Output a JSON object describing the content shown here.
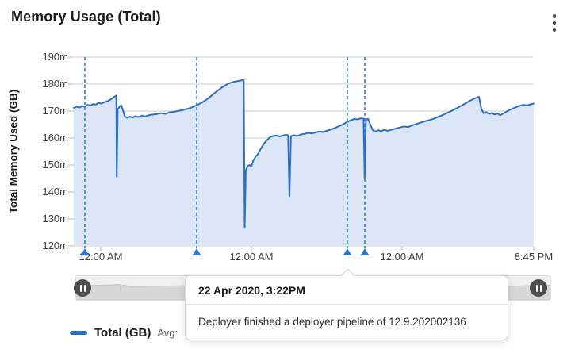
{
  "header": {
    "title": "Memory Usage (Total)"
  },
  "colors": {
    "line": "#2b6fc2",
    "fill": "#dbe5f6",
    "annotation": "#2f72cf",
    "grid": "#cccccc",
    "tick": "#b5b5b5",
    "axis_text": "#3c3c3c",
    "slider_chart_fill": "#d6d6d6",
    "slider_chart_stroke": "#c4c4c4",
    "slider_handle": "#4d4d4d"
  },
  "chart_data": {
    "type": "area",
    "title": "Memory Usage (Total)",
    "ylabel": "Total Memory Used (GB)",
    "xlabel": "",
    "ylim": [
      120,
      190
    ],
    "grid": true,
    "y_ticks": [
      {
        "value": 190,
        "label": "190m"
      },
      {
        "value": 180,
        "label": "180m"
      },
      {
        "value": 170,
        "label": "170m"
      },
      {
        "value": 160,
        "label": "160m"
      },
      {
        "value": 150,
        "label": "150m"
      },
      {
        "value": 140,
        "label": "140m"
      },
      {
        "value": 130,
        "label": "130m"
      },
      {
        "value": 120,
        "label": "120m"
      }
    ],
    "x_ticks": [
      {
        "f": 0.0586,
        "label": "12:00 AM"
      },
      {
        "f": 0.3862,
        "label": "12:00 AM"
      },
      {
        "f": 0.7138,
        "label": "12:00 AM"
      },
      {
        "f": 1.0,
        "label": "8:45 PM"
      }
    ],
    "annotations": [
      {
        "f": 0.0241
      },
      {
        "f": 0.2672
      },
      {
        "f": 0.5948,
        "tooltip_target": true
      },
      {
        "f": 0.6328
      }
    ],
    "series": [
      {
        "name": "Total (GB)",
        "points": [
          [
            0.0,
            171.2
          ],
          [
            0.006,
            171.6
          ],
          [
            0.012,
            171.3
          ],
          [
            0.018,
            171.9
          ],
          [
            0.024,
            171.6
          ],
          [
            0.03,
            172.3
          ],
          [
            0.036,
            172.1
          ],
          [
            0.042,
            172.6
          ],
          [
            0.048,
            172.4
          ],
          [
            0.054,
            173.0
          ],
          [
            0.06,
            172.8
          ],
          [
            0.066,
            173.3
          ],
          [
            0.072,
            173.6
          ],
          [
            0.078,
            174.1
          ],
          [
            0.083,
            174.6
          ],
          [
            0.087,
            175.2
          ],
          [
            0.09,
            175.5
          ],
          [
            0.0925,
            175.8
          ],
          [
            0.0935,
            145.7
          ],
          [
            0.0955,
            170.6
          ],
          [
            0.099,
            171.5
          ],
          [
            0.103,
            172.2
          ],
          [
            0.107,
            170.2
          ],
          [
            0.111,
            168.0
          ],
          [
            0.116,
            167.5
          ],
          [
            0.122,
            167.9
          ],
          [
            0.128,
            167.6
          ],
          [
            0.134,
            168.1
          ],
          [
            0.141,
            167.8
          ],
          [
            0.148,
            168.3
          ],
          [
            0.156,
            168.0
          ],
          [
            0.164,
            168.5
          ],
          [
            0.172,
            168.7
          ],
          [
            0.181,
            168.9
          ],
          [
            0.19,
            169.2
          ],
          [
            0.199,
            169.0
          ],
          [
            0.208,
            169.5
          ],
          [
            0.217,
            169.7
          ],
          [
            0.226,
            170.0
          ],
          [
            0.235,
            170.3
          ],
          [
            0.244,
            170.7
          ],
          [
            0.253,
            171.1
          ],
          [
            0.262,
            171.8
          ],
          [
            0.271,
            172.5
          ],
          [
            0.28,
            173.3
          ],
          [
            0.289,
            174.3
          ],
          [
            0.298,
            175.5
          ],
          [
            0.307,
            176.8
          ],
          [
            0.316,
            178.0
          ],
          [
            0.325,
            179.1
          ],
          [
            0.334,
            180.0
          ],
          [
            0.343,
            180.6
          ],
          [
            0.352,
            181.0
          ],
          [
            0.36,
            181.2
          ],
          [
            0.367,
            181.5
          ],
          [
            0.3695,
            181.5
          ],
          [
            0.3715,
            127.0
          ],
          [
            0.374,
            148.0
          ],
          [
            0.378,
            149.5
          ],
          [
            0.382,
            150.0
          ],
          [
            0.386,
            149.5
          ],
          [
            0.39,
            151.5
          ],
          [
            0.395,
            153.0
          ],
          [
            0.4,
            154.0
          ],
          [
            0.405,
            155.5
          ],
          [
            0.41,
            157.0
          ],
          [
            0.415,
            158.3
          ],
          [
            0.42,
            159.2
          ],
          [
            0.426,
            160.2
          ],
          [
            0.432,
            160.7
          ],
          [
            0.44,
            160.9
          ],
          [
            0.448,
            160.6
          ],
          [
            0.456,
            161.0
          ],
          [
            0.462,
            161.2
          ],
          [
            0.466,
            161.0
          ],
          [
            0.469,
            138.5
          ],
          [
            0.472,
            160.7
          ],
          [
            0.478,
            161.0
          ],
          [
            0.486,
            160.8
          ],
          [
            0.494,
            161.3
          ],
          [
            0.502,
            161.6
          ],
          [
            0.51,
            161.9
          ],
          [
            0.518,
            161.7
          ],
          [
            0.526,
            162.1
          ],
          [
            0.534,
            162.4
          ],
          [
            0.542,
            162.2
          ],
          [
            0.55,
            162.7
          ],
          [
            0.558,
            163.1
          ],
          [
            0.566,
            163.6
          ],
          [
            0.574,
            164.2
          ],
          [
            0.582,
            164.8
          ],
          [
            0.589,
            165.4
          ],
          [
            0.596,
            166.1
          ],
          [
            0.603,
            166.6
          ],
          [
            0.61,
            167.1
          ],
          [
            0.617,
            166.9
          ],
          [
            0.624,
            167.3
          ],
          [
            0.63,
            167.2
          ],
          [
            0.6325,
            145.3
          ],
          [
            0.635,
            166.9
          ],
          [
            0.64,
            167.1
          ],
          [
            0.645,
            164.8
          ],
          [
            0.65,
            162.9
          ],
          [
            0.656,
            162.4
          ],
          [
            0.662,
            162.9
          ],
          [
            0.668,
            162.5
          ],
          [
            0.675,
            163.0
          ],
          [
            0.683,
            162.7
          ],
          [
            0.691,
            163.1
          ],
          [
            0.7,
            163.5
          ],
          [
            0.709,
            163.9
          ],
          [
            0.718,
            164.3
          ],
          [
            0.727,
            164.1
          ],
          [
            0.736,
            164.7
          ],
          [
            0.745,
            165.2
          ],
          [
            0.754,
            165.7
          ],
          [
            0.763,
            166.2
          ],
          [
            0.772,
            166.6
          ],
          [
            0.781,
            167.1
          ],
          [
            0.79,
            167.7
          ],
          [
            0.799,
            168.3
          ],
          [
            0.808,
            169.0
          ],
          [
            0.817,
            169.7
          ],
          [
            0.826,
            170.5
          ],
          [
            0.835,
            171.3
          ],
          [
            0.844,
            172.1
          ],
          [
            0.852,
            172.9
          ],
          [
            0.86,
            173.7
          ],
          [
            0.868,
            174.4
          ],
          [
            0.875,
            174.9
          ],
          [
            0.881,
            175.3
          ],
          [
            0.886,
            170.9
          ],
          [
            0.891,
            169.2
          ],
          [
            0.897,
            169.6
          ],
          [
            0.903,
            168.9
          ],
          [
            0.909,
            169.3
          ],
          [
            0.915,
            168.7
          ],
          [
            0.921,
            169.1
          ],
          [
            0.927,
            168.5
          ],
          [
            0.933,
            169.0
          ],
          [
            0.939,
            169.6
          ],
          [
            0.946,
            170.3
          ],
          [
            0.954,
            170.9
          ],
          [
            0.962,
            171.5
          ],
          [
            0.97,
            172.0
          ],
          [
            0.978,
            172.3
          ],
          [
            0.986,
            172.1
          ],
          [
            0.993,
            172.5
          ],
          [
            1.0,
            172.8
          ]
        ]
      }
    ],
    "legend_position": "bottom-left"
  },
  "tooltip": {
    "timestamp": "22 Apr 2020, 3:22PM",
    "message": "Deployer finished a deployer pipeline of 12.9.202002136"
  },
  "legend": {
    "label": "Total (GB)",
    "avg_label": "Avg:"
  }
}
